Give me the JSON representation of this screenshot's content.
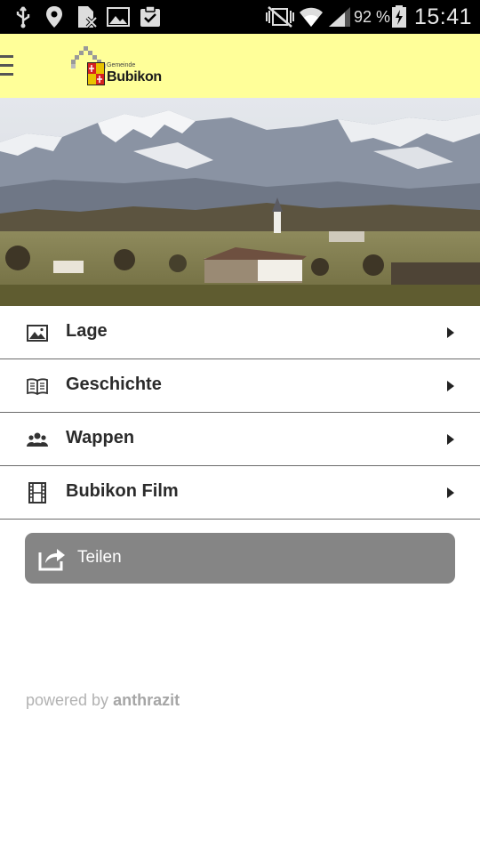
{
  "status_bar": {
    "battery_percent": "92 %",
    "time": "15:41"
  },
  "header": {
    "logo_small_text": "Gemeinde",
    "logo_main_text": "Bubikon"
  },
  "menu": {
    "items": [
      {
        "label": "Lage",
        "icon": "image-icon"
      },
      {
        "label": "Geschichte",
        "icon": "book-icon"
      },
      {
        "label": "Wappen",
        "icon": "people-icon"
      },
      {
        "label": "Bubikon Film",
        "icon": "film-icon"
      }
    ]
  },
  "share": {
    "label": "Teilen"
  },
  "footer": {
    "powered_prefix": "powered by",
    "powered_brand": "anthrazit"
  },
  "colors": {
    "header_bg": "#ffff99",
    "share_bg": "#858585",
    "status_bg": "#000000"
  }
}
